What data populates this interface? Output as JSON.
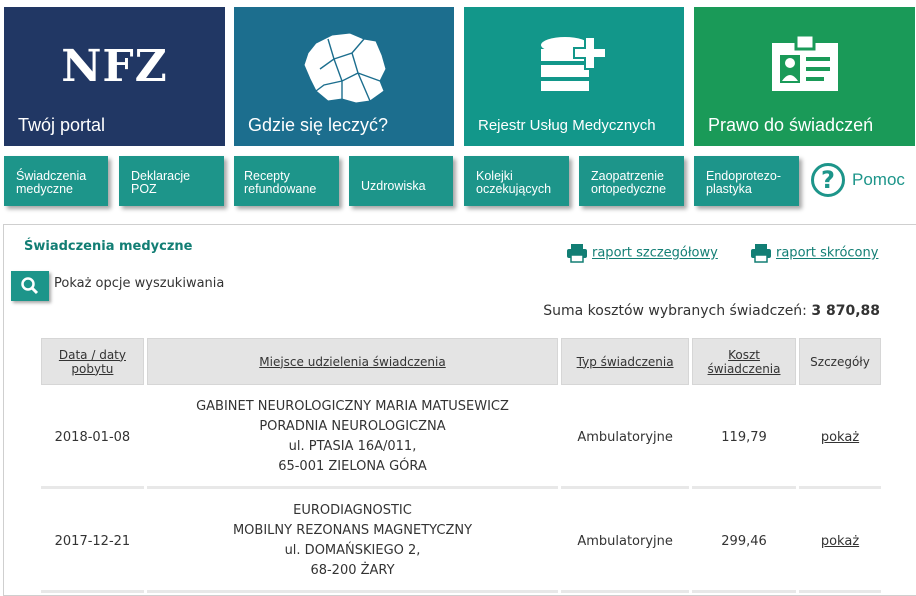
{
  "tiles": [
    {
      "label": "Twój portal",
      "logo": "NFZ"
    },
    {
      "label": "Gdzie się leczyć?"
    },
    {
      "label": "Rejestr Usług Medycznych"
    },
    {
      "label": "Prawo do świadczeń"
    }
  ],
  "nav": [
    {
      "label": "Świadczenia\nmedyczne"
    },
    {
      "label": "Deklaracje\nPOZ"
    },
    {
      "label": "Recepty\nrefundowane"
    },
    {
      "label": "Uzdrowiska"
    },
    {
      "label": "Kolejki\noczekujących"
    },
    {
      "label": "Zaopatrzenie\nortopedyczne"
    },
    {
      "label": "Endoprotezo-\nplastyka"
    }
  ],
  "help": {
    "label": "Pomoc"
  },
  "colors": {
    "portal": "#213764",
    "gdzie": "#1c6e8e",
    "rejestr": "#12978a",
    "prawo": "#1a9a58",
    "accent": "#1d958a"
  },
  "panel": {
    "title": "Świadczenia medyczne",
    "report_detailed": "raport szczegółowy",
    "report_short": "raport skrócony",
    "search_toggle": "Pokaż opcje wyszukiwania",
    "sum_label": "Suma kosztów wybranych świadczeń:",
    "sum_value": "3 870,88"
  },
  "table": {
    "headers": [
      "Data / daty pobytu",
      "Miejsce udzielenia świadczenia",
      "Typ świadczenia",
      "Koszt świadczenia",
      "Szczegóły"
    ],
    "rows": [
      {
        "date": "2018-01-08",
        "place": [
          "GABINET NEUROLOGICZNY MARIA MATUSEWICZ",
          "PORADNIA NEUROLOGICZNA",
          "ul. PTASIA 16A/011,",
          "65-001 ZIELONA GÓRA"
        ],
        "type": "Ambulatoryjne",
        "cost": "119,79",
        "details": "pokaż"
      },
      {
        "date": "2017-12-21",
        "place": [
          "EURODIAGNOSTIC",
          "MOBILNY REZONANS MAGNETYCZNY",
          "ul. DOMAŃSKIEGO 2,",
          "68-200 ŻARY"
        ],
        "type": "Ambulatoryjne",
        "cost": "299,46",
        "details": "pokaż"
      }
    ]
  }
}
